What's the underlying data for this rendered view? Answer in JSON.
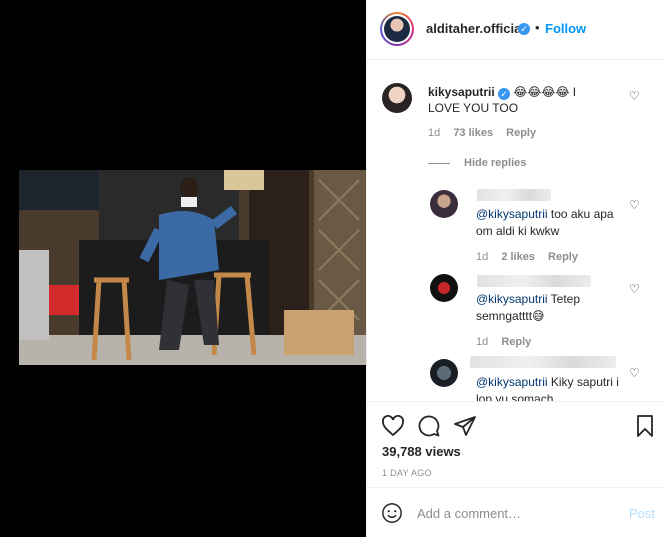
{
  "post": {
    "author": "alditaher.official",
    "dot": "•",
    "follow_label": "Follow"
  },
  "main_comment": {
    "username": "kikysaputrii",
    "text": "😂😂😂😂 I LOVE YOU TOO",
    "time": "1d",
    "likes": "73 likes",
    "reply_label": "Reply"
  },
  "hide_replies_label": "Hide replies",
  "replies": [
    {
      "mention": "@kikysaputrii",
      "text": " too aku apa om aldi ki kwkw",
      "time": "1d",
      "likes": "2 likes",
      "reply_label": "Reply"
    },
    {
      "mention": "@kikysaputrii",
      "text": " Tetep semngatttt😅",
      "time": "1d",
      "likes": "",
      "reply_label": "Reply"
    },
    {
      "mention": "@kikysaputrii",
      "text": " Kiky saputri i lop yu somach",
      "time": "",
      "likes": "",
      "reply_label": ""
    }
  ],
  "stats": {
    "views": "39,788 views",
    "posted": "1 DAY AGO"
  },
  "add_comment": {
    "placeholder": "Add a comment…",
    "post_label": "Post"
  },
  "colors": {
    "accent": "#0095f6",
    "verified": "#3897f0",
    "muted": "#8e8e8e",
    "post_disabled": "#b2dffc"
  },
  "icons": [
    "heart-icon",
    "comment-icon",
    "share-icon",
    "bookmark-icon",
    "emoji-icon",
    "verified-icon"
  ]
}
